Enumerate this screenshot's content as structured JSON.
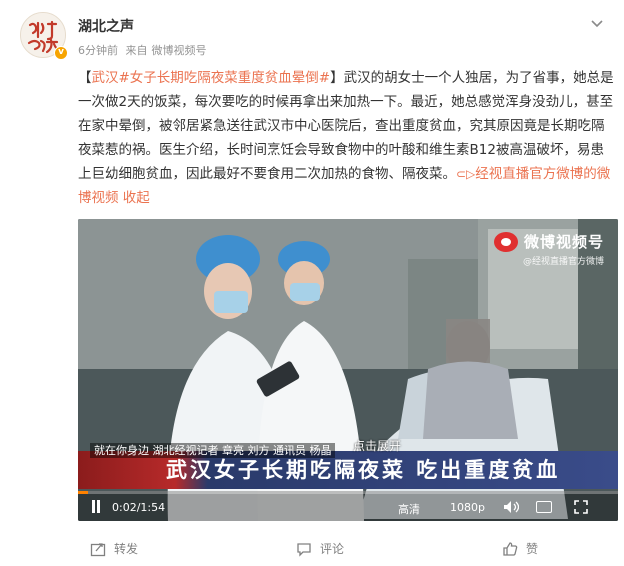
{
  "header": {
    "avatar_text": "湖北之声",
    "author": "湖北之声",
    "time": "6分钟前",
    "source_prefix": "来自",
    "source": "微博视频号"
  },
  "post": {
    "bracket_open": "【",
    "tag_city": "武汉",
    "hashtag": "#女子长期吃隔夜菜重度贫血晕倒#",
    "bracket_close": "】",
    "body": "武汉的胡女士一个人独居，为了省事，她总是一次做2天的饭菜，每次要吃的时候再拿出来加热一下。最近，她总感觉浑身没劲儿，甚至在家中晕倒，被邻居紧急送往武汉市中心医院后，查出重度贫血，究其原因竟是长期吃隔夜菜惹的祸。医生介绍，长时间烹饪会导致食物中的叶酸和维生素B12被高温破坏，易患上巨幼细胞贫血，因此最好不要食用二次加热的食物、隔夜菜。",
    "video_link_icon": "⊂▷",
    "video_link": "经视直播官方微博的微博视频",
    "collapse": "收起"
  },
  "video": {
    "watermark_title": "微博视频号",
    "watermark_sub": "@经视直播官方微博",
    "expand_label": "点击展开",
    "lower_third_top": "就在你身边  湖北经视记者 章亮  刘方  通讯员 杨晶",
    "headline": "武汉女子长期吃隔夜菜 吃出重度贫血",
    "current_time": "0:02",
    "duration": "1:54",
    "progress": 0.018,
    "quality_1": "高清",
    "quality_2": "1080p",
    "accent": "#ff8200"
  },
  "actions": {
    "repost": "转发",
    "comment": "评论",
    "like": "赞"
  },
  "colors": {
    "link": "#eb7350",
    "text": "#333333",
    "meta": "#939393"
  }
}
